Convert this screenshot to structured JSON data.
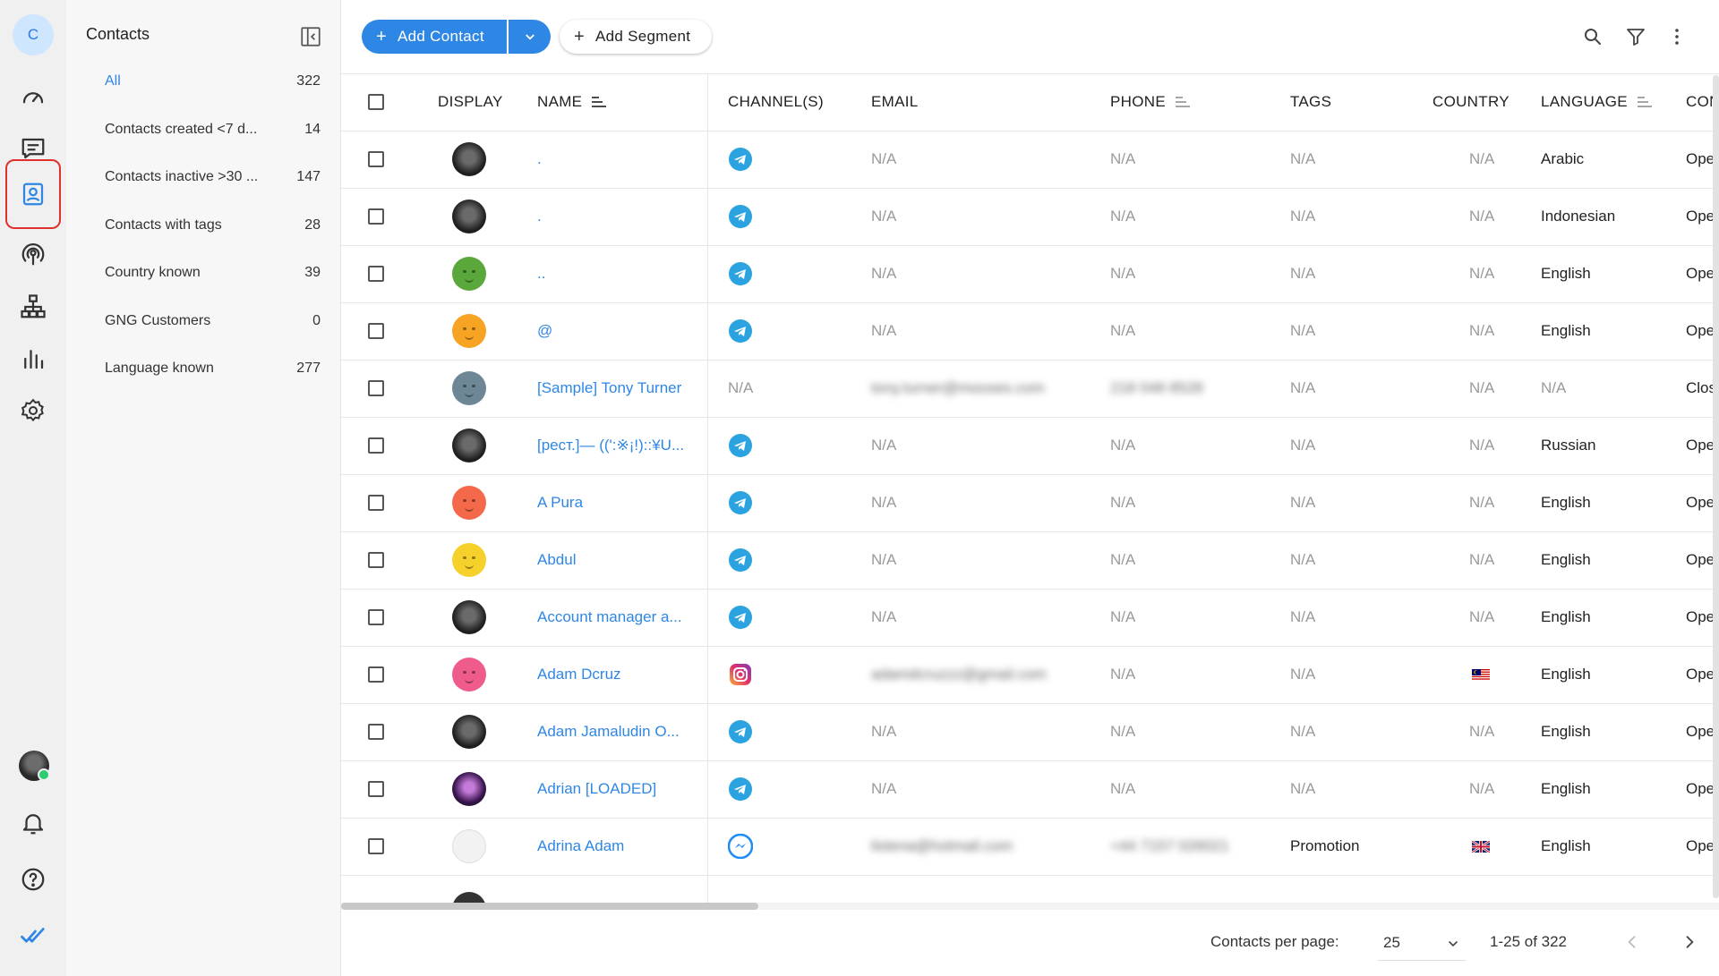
{
  "app": {
    "org_initial": "C",
    "accent_color": "#2f87e5",
    "active_nav_color": "#e0302b"
  },
  "rail": {
    "items": [
      {
        "name": "dashboard",
        "icon": "speedometer-icon",
        "active": false
      },
      {
        "name": "messages",
        "icon": "chat-icon",
        "active": false
      },
      {
        "name": "contacts",
        "icon": "contact-card-icon",
        "active": true
      },
      {
        "name": "broadcasts",
        "icon": "broadcast-icon",
        "active": false
      },
      {
        "name": "workflows",
        "icon": "workflow-icon",
        "active": false
      },
      {
        "name": "reports",
        "icon": "bar-chart-icon",
        "active": false
      },
      {
        "name": "settings",
        "icon": "gear-icon",
        "active": false
      }
    ],
    "bottom": [
      "user-avatar",
      "bell-icon",
      "help-icon",
      "double-check-logo-icon"
    ]
  },
  "segments": {
    "title": "Contacts",
    "items": [
      {
        "name": "All",
        "count": "322",
        "active": true
      },
      {
        "name": "Contacts created <7 d...",
        "count": "14"
      },
      {
        "name": "Contacts inactive >30 ...",
        "count": "147"
      },
      {
        "name": "Contacts with tags",
        "count": "28"
      },
      {
        "name": "Country known",
        "count": "39"
      },
      {
        "name": "GNG Customers",
        "count": "0"
      },
      {
        "name": "Language known",
        "count": "277"
      }
    ]
  },
  "toolbar": {
    "add_contact_label": "Add Contact",
    "add_segment_label": "Add Segment"
  },
  "table": {
    "columns": {
      "display": "DISPLAY",
      "name": "NAME",
      "channels": "CHANNEL(S)",
      "email": "EMAIL",
      "phone": "PHONE",
      "tags": "TAGS",
      "country": "COUNTRY",
      "language": "LANGUAGE",
      "conversation": "CON"
    },
    "rows": [
      {
        "name": ".",
        "channel": "telegram",
        "email": "N/A",
        "phone": "N/A",
        "tags": "N/A",
        "country": "N/A",
        "language": "Arabic",
        "status": "Ope",
        "avatar": "photo-dark"
      },
      {
        "name": ".",
        "channel": "telegram",
        "email": "N/A",
        "phone": "N/A",
        "tags": "N/A",
        "country": "N/A",
        "language": "Indonesian",
        "status": "Ope",
        "avatar": "photo-dark"
      },
      {
        "name": "..",
        "channel": "telegram",
        "email": "N/A",
        "phone": "N/A",
        "tags": "N/A",
        "country": "N/A",
        "language": "English",
        "status": "Ope",
        "avatar": "emoji-green"
      },
      {
        "name": "@",
        "channel": "telegram",
        "email": "N/A",
        "phone": "N/A",
        "tags": "N/A",
        "country": "N/A",
        "language": "English",
        "status": "Ope",
        "avatar": "emoji-orange"
      },
      {
        "name": "[Sample] Tony Turner",
        "channel": "N/A",
        "email": "tony.turner@mooses.com",
        "phone": "218 048 8528",
        "tags": "N/A",
        "country": "N/A",
        "language": "N/A",
        "status": "Clos",
        "avatar": "emoji-slate"
      },
      {
        "name": "[рест.]— ((':※¡!)::¥U...",
        "channel": "telegram",
        "email": "N/A",
        "phone": "N/A",
        "tags": "N/A",
        "country": "N/A",
        "language": "Russian",
        "status": "Ope",
        "avatar": "photo-dark"
      },
      {
        "name": "A Pura",
        "channel": "telegram",
        "email": "N/A",
        "phone": "N/A",
        "tags": "N/A",
        "country": "N/A",
        "language": "English",
        "status": "Ope",
        "avatar": "emoji-red"
      },
      {
        "name": "Abdul",
        "channel": "telegram",
        "email": "N/A",
        "phone": "N/A",
        "tags": "N/A",
        "country": "N/A",
        "language": "English",
        "status": "Ope",
        "avatar": "emoji-yellow"
      },
      {
        "name": "Account manager a...",
        "channel": "telegram",
        "email": "N/A",
        "phone": "N/A",
        "tags": "N/A",
        "country": "N/A",
        "language": "English",
        "status": "Ope",
        "avatar": "photo-dark"
      },
      {
        "name": "Adam Dcruz",
        "channel": "instagram",
        "email": "adamdcruzzz@gmail.com",
        "phone": "N/A",
        "tags": "N/A",
        "country": "MY",
        "language": "English",
        "status": "Ope",
        "avatar": "emoji-pink"
      },
      {
        "name": "Adam Jamaludin O...",
        "channel": "telegram",
        "email": "N/A",
        "phone": "N/A",
        "tags": "N/A",
        "country": "N/A",
        "language": "English",
        "status": "Ope",
        "avatar": "photo-dark"
      },
      {
        "name": "Adrian [LOADED]",
        "channel": "telegram",
        "email": "N/A",
        "phone": "N/A",
        "tags": "N/A",
        "country": "N/A",
        "language": "English",
        "status": "Ope",
        "avatar": "photo-purple"
      },
      {
        "name": "Adrina Adam",
        "channel": "messenger",
        "email": "listena@hotmail.com",
        "phone": "+44 7157 026021",
        "tags": "Promotion",
        "country": "GB",
        "language": "English",
        "status": "Ope",
        "avatar": "placeholder"
      }
    ]
  },
  "pagination": {
    "per_page_label": "Contacts per page:",
    "per_page_value": "25",
    "range_text": "1-25 of 322"
  }
}
